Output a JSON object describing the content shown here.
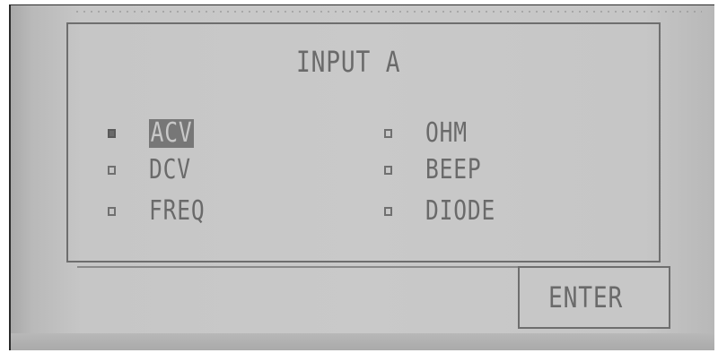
{
  "dialog": {
    "title": "INPUT A",
    "options": [
      {
        "label": "ACV",
        "checked": true,
        "selected": true
      },
      {
        "label": "DCV",
        "checked": false,
        "selected": false
      },
      {
        "label": "FREQ",
        "checked": false,
        "selected": false
      },
      {
        "label": "OHM",
        "checked": false,
        "selected": false
      },
      {
        "label": "BEEP",
        "checked": false,
        "selected": false
      },
      {
        "label": "DIODE",
        "checked": false,
        "selected": false
      }
    ]
  },
  "buttons": {
    "enter_label": "ENTER"
  },
  "colors": {
    "lcd_background": "#c7c7c7",
    "lcd_text": "#6a6a6a",
    "selection_highlight": "#777777"
  }
}
